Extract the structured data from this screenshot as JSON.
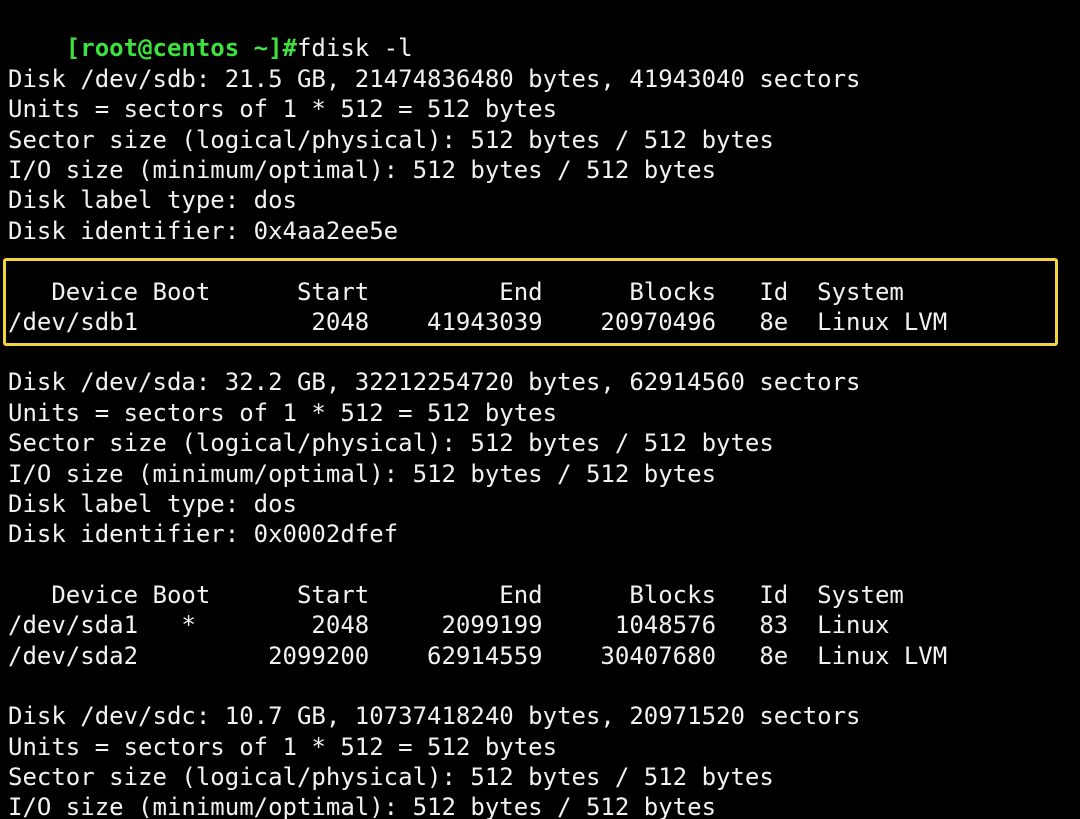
{
  "terminal": {
    "prompt": "[root@centos ~]#",
    "command": "fdisk -l",
    "lines": [
      "Disk /dev/sdb: 21.5 GB, 21474836480 bytes, 41943040 sectors",
      "Units = sectors of 1 * 512 = 512 bytes",
      "Sector size (logical/physical): 512 bytes / 512 bytes",
      "I/O size (minimum/optimal): 512 bytes / 512 bytes",
      "Disk label type: dos",
      "Disk identifier: 0x4aa2ee5e",
      "",
      "   Device Boot      Start         End      Blocks   Id  System",
      "/dev/sdb1            2048    41943039    20970496   8e  Linux LVM",
      "",
      "Disk /dev/sda: 32.2 GB, 32212254720 bytes, 62914560 sectors",
      "Units = sectors of 1 * 512 = 512 bytes",
      "Sector size (logical/physical): 512 bytes / 512 bytes",
      "I/O size (minimum/optimal): 512 bytes / 512 bytes",
      "Disk label type: dos",
      "Disk identifier: 0x0002dfef",
      "",
      "   Device Boot      Start         End      Blocks   Id  System",
      "/dev/sda1   *        2048     2099199     1048576   83  Linux",
      "/dev/sda2         2099200    62914559    30407680   8e  Linux LVM",
      "",
      "Disk /dev/sdc: 10.7 GB, 10737418240 bytes, 20971520 sectors",
      "Units = sectors of 1 * 512 = 512 bytes",
      "Sector size (logical/physical): 512 bytes / 512 bytes",
      "I/O size (minimum/optimal): 512 bytes / 512 bytes"
    ]
  },
  "colors": {
    "background": "#000000",
    "text": "#f2f2f2",
    "prompt": "#3ee23e",
    "highlight_border": "#f3d43a"
  }
}
